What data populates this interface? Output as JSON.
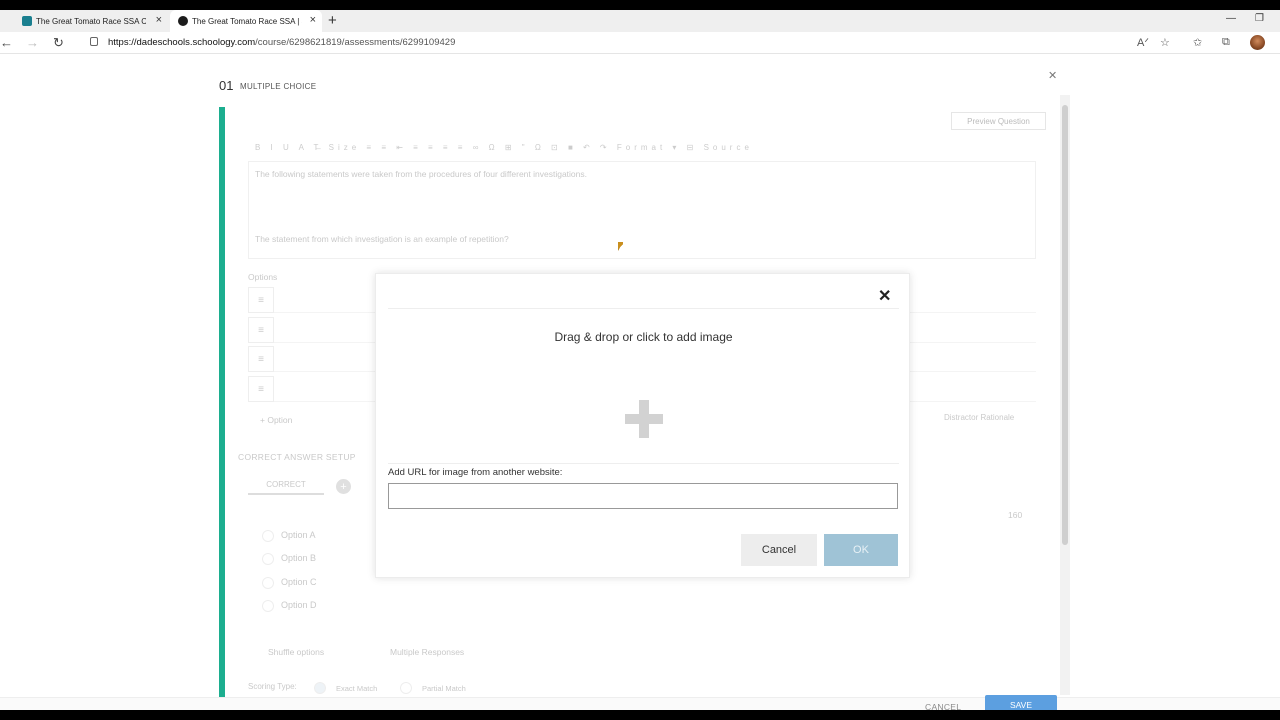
{
  "browser": {
    "tabs": [
      {
        "title": "The Great Tomato Race SSA Con",
        "active": false,
        "icon": "teams-icon",
        "color": "#1a7f8f"
      },
      {
        "title": "The Great Tomato Race SSA | Sch",
        "active": true,
        "icon": "schoology-icon",
        "color": "#1c1c1c"
      }
    ],
    "url_host": "https://dadeschools.schoology.com",
    "url_path": "/course/6298621819/assessments/6299109429"
  },
  "question": {
    "number": "01",
    "type_label": "MULTIPLE CHOICE",
    "preview_label": "Preview Question",
    "toolbar_text": "B I U A T̶ Size ≡ ≡ ⇤ ≡ ≡ ≡ ≡ ∞ Ω ⊞ \" Ω ⊡ ■ ↶ ↷ Format ▾ ⊟ Source",
    "text_line1": "The following statements were taken from the procedures of four different investigations.",
    "text_line2": "The statement from which investigation is an example of repetition?",
    "options_label": "Options",
    "add_option_label": "Option",
    "distractor_label": "Distractor Rationale",
    "correct_answer_setup": "CORRECT ANSWER SETUP",
    "correct_tab": "CORRECT",
    "points": "160",
    "answer_options": [
      "Option A",
      "Option B",
      "Option C",
      "Option D"
    ],
    "shuffle_label": "Shuffle options",
    "multiple_label": "Multiple Responses",
    "scoring_label": "Scoring Type:",
    "exact_match": "Exact Match",
    "partial_match": "Partial Match"
  },
  "footer": {
    "cancel": "CANCEL",
    "save": "SAVE"
  },
  "modal": {
    "drop_text": "Drag & drop or click to add image",
    "url_label": "Add URL for image from another website:",
    "url_value": "",
    "cancel": "Cancel",
    "ok": "OK"
  },
  "colors": {
    "accent_teal": "#1cae8f",
    "save_blue": "#5c9fe0",
    "ok_disabled": "#9fc3d6"
  }
}
